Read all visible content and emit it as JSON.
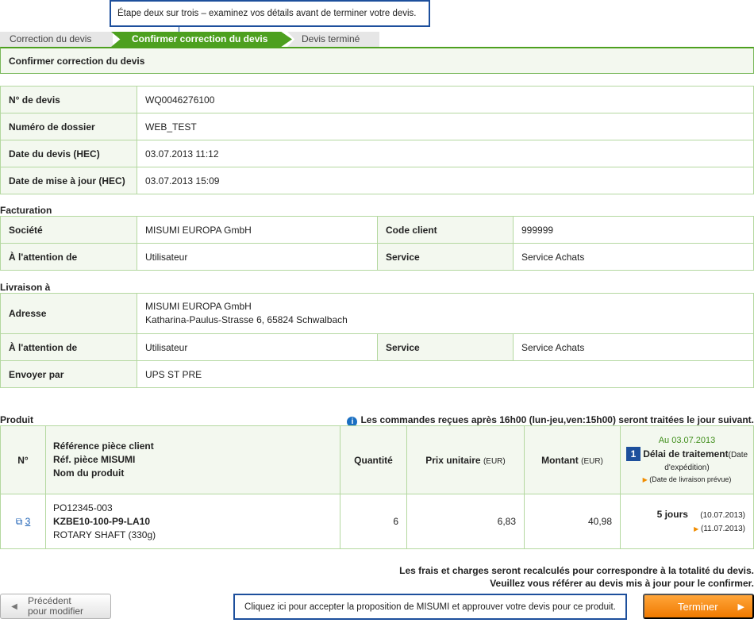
{
  "callout_top": "Étape deux sur trois – examinez vos détails avant de terminer votre devis.",
  "steps": [
    "Correction du devis",
    "Confirmer correction du devis",
    "Devis terminé"
  ],
  "page_title": "Confirmer correction du devis",
  "quote": {
    "rows": [
      {
        "label": "N° de devis",
        "value": "WQ0046276100"
      },
      {
        "label": "Numéro de dossier",
        "value": "WEB_TEST"
      },
      {
        "label": "Date du devis (HEC)",
        "value": "03.07.2013 11:12"
      },
      {
        "label": "Date de mise à jour (HEC)",
        "value": "03.07.2013 15:09"
      }
    ]
  },
  "billing": {
    "section": "Facturation",
    "company_label": "Société",
    "company": "MISUMI EUROPA GmbH",
    "client_code_label": "Code client",
    "client_code": "999999",
    "attention_label": "À l'attention de",
    "attention": "Utilisateur",
    "service_label": "Service",
    "service": "Service Achats"
  },
  "delivery": {
    "section": "Livraison à",
    "address_label": "Adresse",
    "address_line1": "MISUMI EUROPA GmbH",
    "address_line2": "Katharina-Paulus-Strasse 6, 65824 Schwalbach",
    "attention_label": "À l'attention de",
    "attention": "Utilisateur",
    "service_label": "Service",
    "service": "Service Achats",
    "ship_label": "Envoyer par",
    "ship": "UPS ST PRE"
  },
  "product": {
    "section": "Produit",
    "notice": "Les commandes reçues après 16h00 (lun-jeu,ven:15h00) seront traitées le jour suivant.",
    "headers": {
      "no": "N°",
      "ref_client": "Référence pièce client",
      "ref_misumi": "Réf. pièce MISUMI",
      "name": "Nom du produit",
      "qty": "Quantité",
      "unit_price": "Prix unitaire",
      "amount": "Montant",
      "currency": "(EUR)",
      "as_of": "Au 03.07.2013",
      "badge": "1",
      "lead_time": "Délai de traitement",
      "ship_date": "(Date d'expédition)",
      "delivery_date": "(Date de livraison prévue)"
    },
    "row": {
      "no": "3",
      "ref_client": "PO12345-003",
      "ref_misumi": "KZBE10-100-P9-LA10",
      "name": "ROTARY SHAFT (330g)",
      "qty": "6",
      "unit_price": "6,83",
      "amount": "40,98",
      "days": "5 jours",
      "ship_date": "(10.07.2013)",
      "delivery_date": "(11.07.2013)"
    }
  },
  "footer_notice_1": "Les frais et charges seront recalculés pour correspondre à la totalité du devis.",
  "footer_notice_2": "Veuillez vous référer au devis mis à jour pour le confirmer.",
  "btn_prev_line1": "Précédent",
  "btn_prev_line2": "pour modifier",
  "callout_bottom": "Cliquez ici pour accepter la proposition de MISUMI et approuver votre devis pour ce produit.",
  "btn_finish": "Terminer",
  "colors": {
    "accent_green": "#4da01f",
    "callout_blue": "#1d4f9c",
    "finish_orange": "#f07a00"
  }
}
